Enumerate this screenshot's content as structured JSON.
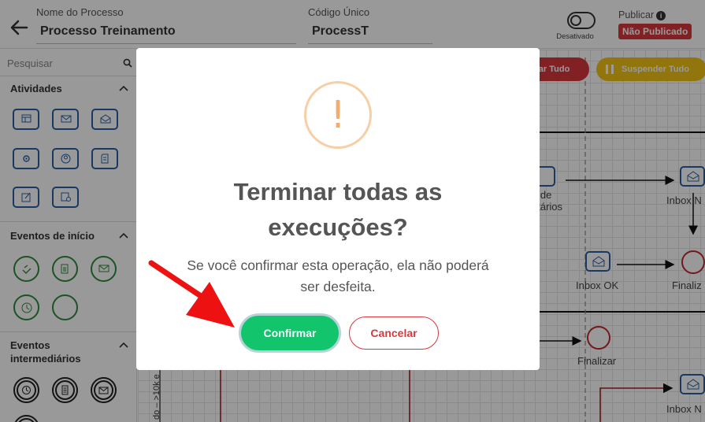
{
  "header": {
    "process_name_label": "Nome do Processo",
    "process_name_value": "Processo Treinamento",
    "unique_code_label": "Código Único",
    "unique_code_value": "ProcessT",
    "toggle_label": "Desativado",
    "publish_label": "Publicar",
    "publish_status": "Não Publicado"
  },
  "sidebar": {
    "search_placeholder": "Pesquisar",
    "sections": {
      "activities": "Atividades",
      "start_events": "Eventos de início",
      "intermediate_events": "Eventos intermediários"
    }
  },
  "canvas": {
    "terminate_all_label": "inar Tudo",
    "suspend_all_label": "Suspender Tudo",
    "nodes": {
      "recipients_text_1": "a de",
      "recipients_text_2": "atários",
      "inbox_n_1": "Inbox N",
      "inbox_ok": "Inbox OK",
      "finalize_1": "Finaliz",
      "finalize_2": "Finalizar",
      "inbox_n_2": "Inbox N"
    },
    "lane_label": "do – >10k e"
  },
  "modal": {
    "title": "Terminar todas as execuções?",
    "body": "Se você confirmar esta operação, ela não poderá ser desfeita.",
    "confirm_label": "Confirmar",
    "cancel_label": "Cancelar"
  },
  "colors": {
    "danger": "#d9383c",
    "success": "#12c46c",
    "warning": "#f3c414",
    "activity_border": "#2a5fa3",
    "start_event_border": "#2e8b3b",
    "warning_icon": "#f5ab6a"
  }
}
